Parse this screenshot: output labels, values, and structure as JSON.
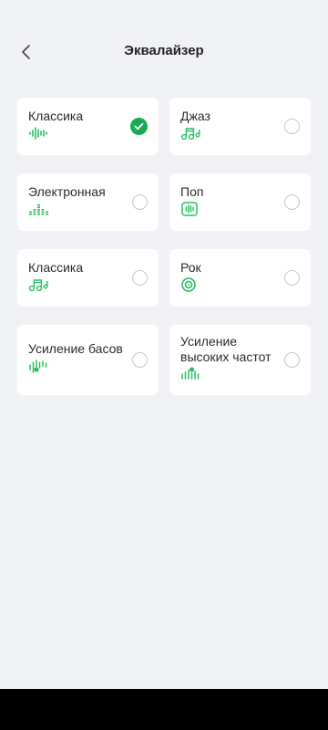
{
  "header": {
    "title": "Эквалайзер"
  },
  "presets": [
    {
      "label": "Классика",
      "icon": "waveform-icon",
      "selected": true
    },
    {
      "label": "Джаз",
      "icon": "music-notes-icon",
      "selected": false
    },
    {
      "label": "Электронная",
      "icon": "equalizer-bars-icon",
      "selected": false
    },
    {
      "label": "Поп",
      "icon": "soundwave-box-icon",
      "selected": false
    },
    {
      "label": "Классика",
      "icon": "music-notes-icon",
      "selected": false
    },
    {
      "label": "Рок",
      "icon": "vinyl-disc-icon",
      "selected": false
    },
    {
      "label": "Усиление басов",
      "icon": "bass-boost-icon",
      "selected": false
    },
    {
      "label": "Усиление высоких частот",
      "icon": "treble-boost-icon",
      "selected": false
    }
  ],
  "colors": {
    "accent": "#1aaa55",
    "background": "#f1f2f6",
    "card": "#ffffff"
  }
}
